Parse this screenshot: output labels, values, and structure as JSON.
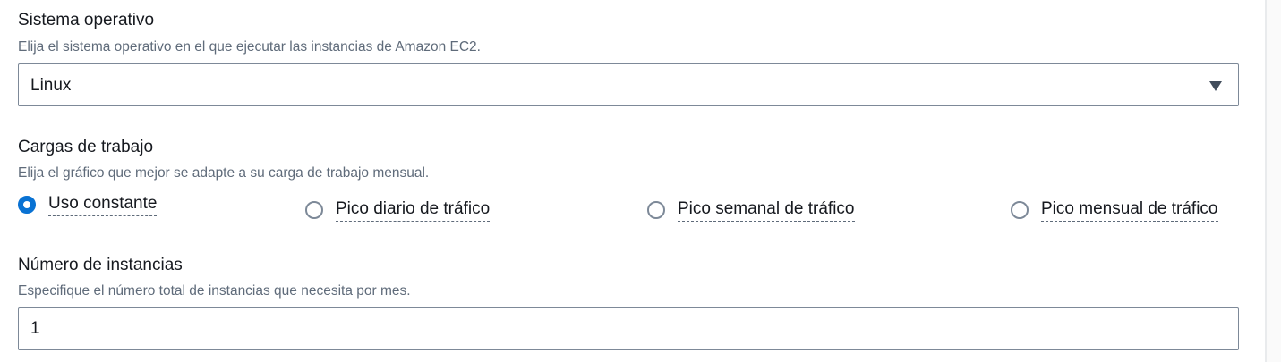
{
  "operating_system": {
    "label": "Sistema operativo",
    "description": "Elija el sistema operativo en el que ejecutar las instancias de Amazon EC2.",
    "selected_value": "Linux"
  },
  "workloads": {
    "label": "Cargas de trabajo",
    "description": "Elija el gráfico que mejor se adapte a su carga de trabajo mensual.",
    "options": [
      {
        "label": "Uso constante",
        "checked": true
      },
      {
        "label": "Pico diario de tráfico",
        "checked": false
      },
      {
        "label": "Pico semanal de tráfico",
        "checked": false
      },
      {
        "label": "Pico mensual de tráfico",
        "checked": false
      }
    ]
  },
  "instances": {
    "label": "Número de instancias",
    "description": "Especifique el número total de instancias que necesita por mes.",
    "value": "1"
  },
  "colors": {
    "accent": "#0972d3",
    "text": "#16191f",
    "secondary_text": "#5f6b7a",
    "border": "#7d8998"
  }
}
